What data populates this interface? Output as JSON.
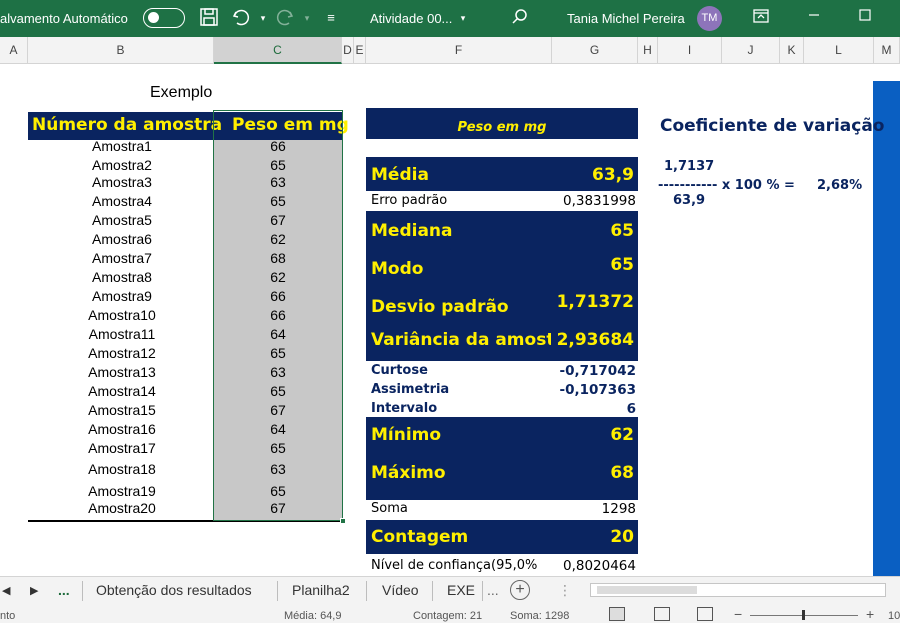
{
  "titlebar": {
    "autosave_label": "alvamento Automático",
    "doc_title": "Atividade 00...",
    "user_name": "Tania Michel Pereira",
    "user_initials": "TM",
    "accent": "#1e7145"
  },
  "columns": [
    "A",
    "B",
    "C",
    "D",
    "E",
    "F",
    "G",
    "H",
    "I",
    "J",
    "K",
    "L",
    "M"
  ],
  "sheet": {
    "example_label": "Exemplo",
    "header_amostra": "Número da amostra",
    "header_peso": "Peso em mg",
    "rows": [
      {
        "amostra": "Amostra1",
        "peso": "66"
      },
      {
        "amostra": "Amostra2",
        "peso": "65"
      },
      {
        "amostra": "Amostra3",
        "peso": "63"
      },
      {
        "amostra": "Amostra4",
        "peso": "65"
      },
      {
        "amostra": "Amostra5",
        "peso": "67"
      },
      {
        "amostra": "Amostra6",
        "peso": "62"
      },
      {
        "amostra": "Amostra7",
        "peso": "68"
      },
      {
        "amostra": "Amostra8",
        "peso": "62"
      },
      {
        "amostra": "Amostra9",
        "peso": "66"
      },
      {
        "amostra": "Amostra10",
        "peso": "66"
      },
      {
        "amostra": "Amostra11",
        "peso": "64"
      },
      {
        "amostra": "Amostra12",
        "peso": "65"
      },
      {
        "amostra": "Amostra13",
        "peso": "63"
      },
      {
        "amostra": "Amostra14",
        "peso": "65"
      },
      {
        "amostra": "Amostra15",
        "peso": "67"
      },
      {
        "amostra": "Amostra16",
        "peso": "64"
      },
      {
        "amostra": "Amostra17",
        "peso": "65"
      },
      {
        "amostra": "Amostra18",
        "peso": "63"
      },
      {
        "amostra": "Amostra19",
        "peso": "65"
      },
      {
        "amostra": "Amostra20",
        "peso": "67"
      }
    ],
    "stats_header": "Peso em mg",
    "stats": {
      "media_label": "Média",
      "media_value": "63,9",
      "erro_label": "Erro padrão",
      "erro_value": "0,3831998",
      "mediana_label": "Mediana",
      "mediana_value": "65",
      "modo_label": "Modo",
      "modo_value": "65",
      "desvio_label": "Desvio padrão",
      "desvio_value": "1,71372",
      "variancia_label": "Variância da amostr",
      "variancia_value": "2,93684",
      "curtose_label": "Curtose",
      "curtose_value": "-0,717042",
      "assimetria_label": "Assimetria",
      "assimetria_value": "-0,107363",
      "intervalo_label": "Intervalo",
      "intervalo_value": "6",
      "minimo_label": "Mínimo",
      "minimo_value": "62",
      "maximo_label": "Máximo",
      "maximo_value": "68",
      "soma_label": "Soma",
      "soma_value": "1298",
      "contagem_label": "Contagem",
      "contagem_value": "20",
      "nivel_label": "Nível de confiança(95,0%",
      "nivel_value": "0,8020464"
    },
    "coef": {
      "title": "Coeficiente de variação",
      "numerator": "1,7137",
      "fraction_line": "----------- x 100 % =",
      "result": "2,68%",
      "denominator": "63,9"
    }
  },
  "tabs": {
    "ellipsis": "...",
    "items": [
      "Obtenção dos resultados",
      "Planilha2",
      "Vídeo",
      "EXE"
    ],
    "more": "..."
  },
  "statusbar": {
    "left": "nto",
    "media": "Média: 64,9",
    "contagem": "Contagem: 21",
    "soma": "Soma: 1298",
    "zoom": "10"
  }
}
